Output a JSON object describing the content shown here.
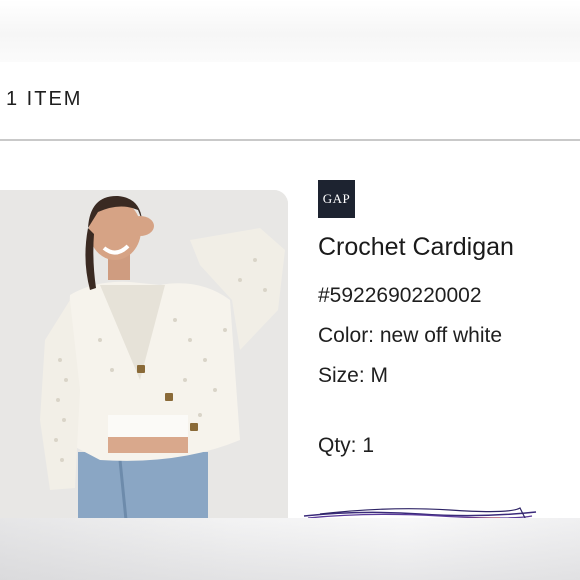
{
  "cart": {
    "item_count_label": "1 ITEM"
  },
  "product": {
    "brand": "GAP",
    "name": "Crochet Cardigan",
    "sku": "#5922690220002",
    "color": "Color: new off white",
    "size": "Size: M",
    "quantity": "Qty: 1",
    "image_alt_icon": "product-photo"
  },
  "colors": {
    "divider": "#c9c9c9",
    "brand_logo_bg": "#1d2330",
    "scribble": "#3a2a7a"
  }
}
